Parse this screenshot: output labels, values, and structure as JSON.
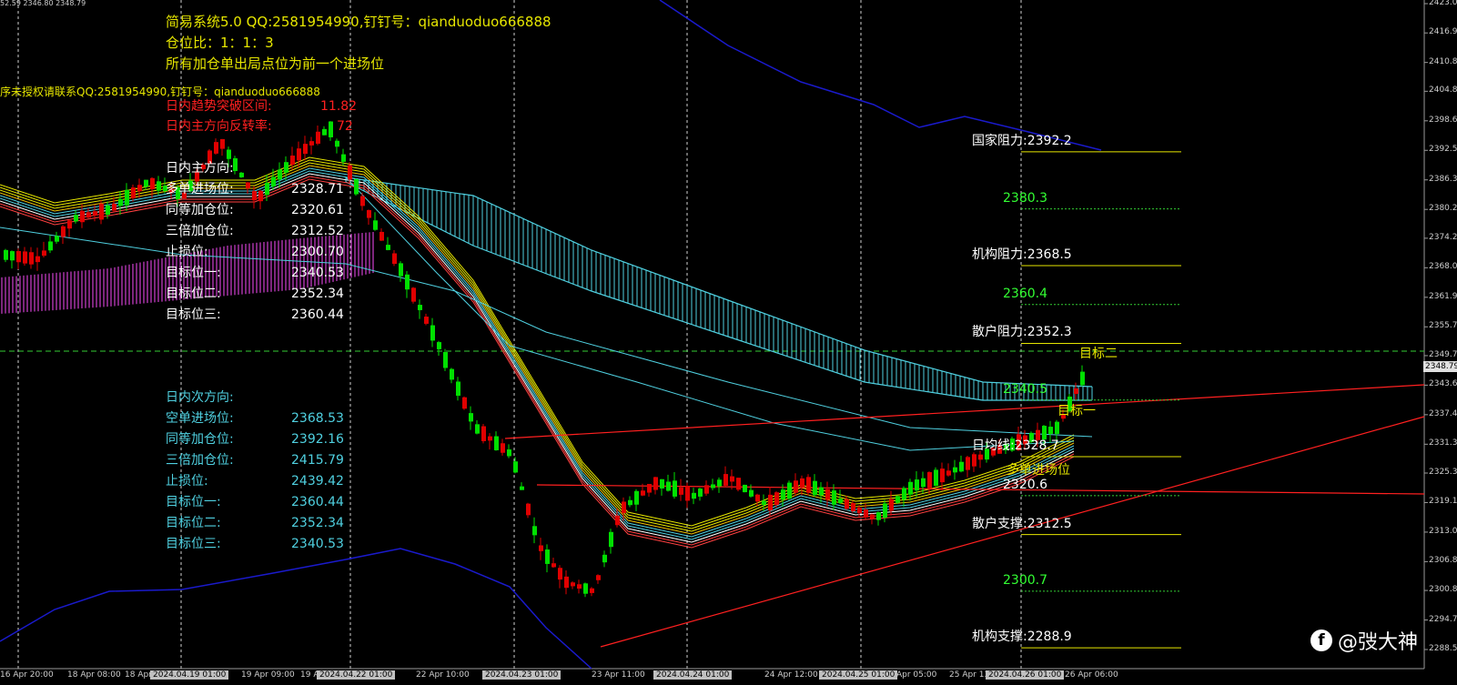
{
  "top_status": "52.59 2346.80 2348.79",
  "header": {
    "line1": "简易系统5.0 QQ:2581954990,钉钉号：qianduoduo666888",
    "line2": "仓位比：1：1：3",
    "line3": "所有加仓单出局点位为前一个进场位",
    "license": "序未授权请联系QQ:2581954990,钉钉号：qianduoduo666888",
    "red1_label": "日内趋势突破区间:",
    "red1_value": "11.82",
    "red2_label": "日内主方向反转率:",
    "red2_value": "72"
  },
  "main_direction": {
    "title": "日内主方向:",
    "rows": [
      {
        "label": "多单进场位:",
        "value": "2328.71"
      },
      {
        "label": "同等加仓位:",
        "value": "2320.61"
      },
      {
        "label": "三倍加仓位:",
        "value": "2312.52"
      },
      {
        "label": "止损位:",
        "value": "2300.70"
      },
      {
        "label": "目标位一:",
        "value": "2340.53"
      },
      {
        "label": "目标位二:",
        "value": "2352.34"
      },
      {
        "label": "目标位三:",
        "value": "2360.44"
      }
    ]
  },
  "secondary_direction": {
    "title": "日内次方向:",
    "rows": [
      {
        "label": "空单进场位:",
        "value": "2368.53"
      },
      {
        "label": "同等加仓位:",
        "value": "2392.16"
      },
      {
        "label": "三倍加仓位:",
        "value": "2415.79"
      },
      {
        "label": "止损位:",
        "value": "2439.42"
      },
      {
        "label": "目标位一:",
        "value": "2360.44"
      },
      {
        "label": "目标位二:",
        "value": "2352.34"
      },
      {
        "label": "目标位三:",
        "value": "2340.53"
      }
    ]
  },
  "levels": [
    {
      "label": "国家阻力:2392.2",
      "price": 2392.2,
      "color": "#ffffff",
      "line": "#e6e600"
    },
    {
      "label": "2380.3",
      "price": 2380.3,
      "color": "#33ff33",
      "line": "#33cc33"
    },
    {
      "label": "机构阻力:2368.5",
      "price": 2368.5,
      "color": "#ffffff",
      "line": "#e6e600"
    },
    {
      "label": "2360.4",
      "price": 2360.4,
      "color": "#33ff33",
      "line": "#33cc33"
    },
    {
      "label": "散户阻力:2352.3",
      "price": 2352.3,
      "color": "#ffffff",
      "line": "#e6e600"
    },
    {
      "label": "2340.5",
      "price": 2340.5,
      "color": "#33ff33",
      "line": "#33cc33"
    },
    {
      "label": "日均线:2328.7",
      "price": 2328.7,
      "color": "#ffffff",
      "line": "#e6e600"
    },
    {
      "label": "2320.6",
      "price": 2320.6,
      "color": "#ffffff",
      "line": "#33cc33"
    },
    {
      "label": "散户支撑:2312.5",
      "price": 2312.5,
      "color": "#ffffff",
      "line": "#e6e600"
    },
    {
      "label": "2300.7",
      "price": 2300.7,
      "color": "#33ff33",
      "line": "#33cc33"
    },
    {
      "label": "机构支撑:2288.9",
      "price": 2288.9,
      "color": "#ffffff",
      "line": "#e6e600"
    }
  ],
  "chart_labels": {
    "target_two": "目标二",
    "target_one": "目标一",
    "long_entry": "多单进场位"
  },
  "y_axis": [
    "2423.05",
    "2416.95",
    "2410.80",
    "2404.80",
    "2398.65",
    "2392.50",
    "2386.35",
    "2380.20",
    "2374.20",
    "2368.05",
    "2361.90",
    "2355.75",
    "2349.75",
    "2343.60",
    "2337.45",
    "2331.30",
    "2325.30",
    "2319.15",
    "2313.00",
    "2306.85",
    "2300.85",
    "2294.70",
    "2288.55"
  ],
  "current_price": "2348.79",
  "x_axis": [
    {
      "label": "16 Apr 20:00",
      "hl": false
    },
    {
      "label": "18 Apr 08:00",
      "hl": false
    },
    {
      "label": "18 Apr",
      "hl": false
    },
    {
      "label": "2024.04.19 01:00",
      "hl": true
    },
    {
      "label": "19 Apr 09:00",
      "hl": false
    },
    {
      "label": "19 Apr",
      "hl": false
    },
    {
      "label": "2024.04.22 01:00",
      "hl": true
    },
    {
      "label": "22 Apr 10:00",
      "hl": false
    },
    {
      "label": "2024.04.23 01:00",
      "hl": true
    },
    {
      "label": "23 Apr 11:00",
      "hl": false
    },
    {
      "label": "2024.04.24 01:00",
      "hl": true
    },
    {
      "label": "24 Apr 12:00",
      "hl": false
    },
    {
      "label": "2024.04.25 01:00",
      "hl": true
    },
    {
      "label": "Apr 05:00",
      "hl": false
    },
    {
      "label": "25 Apr 13:00",
      "hl": false
    },
    {
      "label": "2024.04.26 01:00",
      "hl": true
    },
    {
      "label": "26 Apr 06:00",
      "hl": false
    }
  ],
  "watermark": "@弢大神",
  "colors": {
    "bull": "#00e000",
    "bear": "#e00000",
    "yellow": "#e6e600",
    "cyan": "#4fd0e0",
    "magenta": "#d040d0",
    "blue": "#1a1acc"
  }
}
